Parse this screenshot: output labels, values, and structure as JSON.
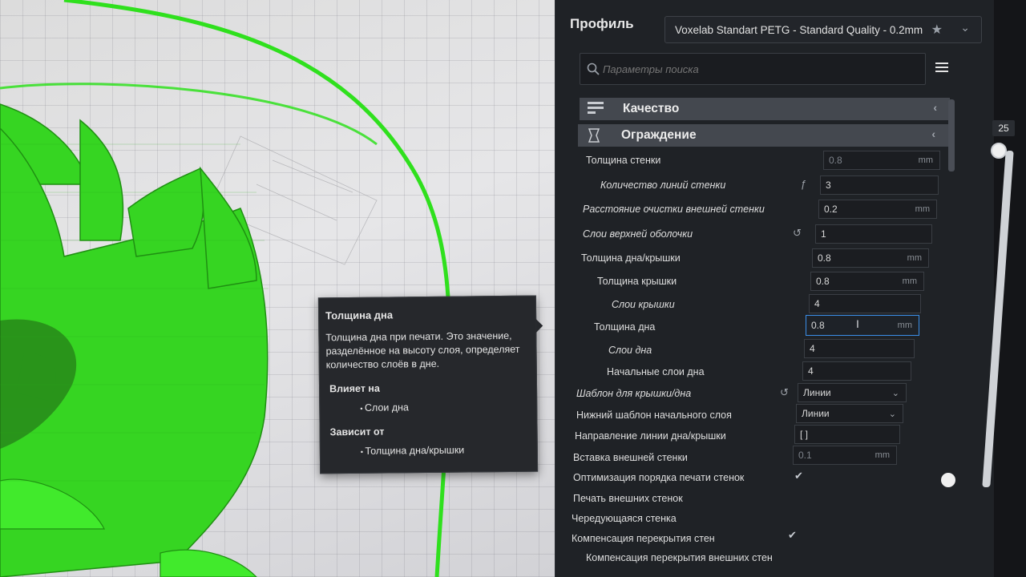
{
  "header": {
    "profile_label": "Профиль",
    "profile_value": "Voxelab Standart PETG - Standard Quality - 0.2mm"
  },
  "search": {
    "placeholder": "Параметры поиска"
  },
  "categories": [
    {
      "label": "Качество",
      "icon": "quality-icon"
    },
    {
      "label": "Ограждение",
      "icon": "shell-icon"
    }
  ],
  "settings": [
    {
      "label": "Толщина стенки",
      "value": "0.8",
      "unit": "mm"
    },
    {
      "label": "Количество линий стенки",
      "value": "3"
    },
    {
      "label": "Расстояние очистки внешней стенки",
      "value": "0.2",
      "unit": "mm"
    },
    {
      "label": "Слои верхней оболочки",
      "value": "1"
    },
    {
      "label": "Толщина дна/крышки",
      "value": "0.8",
      "unit": "mm"
    },
    {
      "label": "Толщина крышки",
      "value": "0.8",
      "unit": "mm"
    },
    {
      "label": "Слои крышки",
      "value": "4"
    },
    {
      "label": "Толщина дна",
      "value": "0.8",
      "unit": "mm"
    },
    {
      "label": "Слои дна",
      "value": "4"
    },
    {
      "label": "Начальные слои дна",
      "value": "4"
    },
    {
      "label": "Шаблон для крышки/дна",
      "value": "Линии"
    },
    {
      "label": "Нижний шаблон начального слоя",
      "value": "Линии"
    },
    {
      "label": "Направление линии дна/крышки",
      "value": "[ ]"
    },
    {
      "label": "Вставка внешней стенки",
      "value": "0.1",
      "unit": "mm"
    },
    {
      "label": "Оптимизация порядка печати стенок",
      "value": ""
    },
    {
      "label": "Печать внешних стенок",
      "value": ""
    },
    {
      "label": "Чередующаяся стенка",
      "value": ""
    },
    {
      "label": "Компенсация перекрытия стен",
      "value": ""
    },
    {
      "label": "Компенсация перекрытия внешних стен",
      "value": ""
    }
  ],
  "tooltip": {
    "title": "Толщина дна",
    "description": "Толщина дна при печати. Это значение, разделённое на высоту слоя, определяет количество слоёв в дне.",
    "affects_label": "Влияет на",
    "affects_item": "Слои дна",
    "depends_label": "Зависит от",
    "depends_item": "Толщина дна/крышки"
  },
  "layer_slider": {
    "value": "25"
  },
  "colors": {
    "model_green": "#3ee02a",
    "panel_bg": "#1f2226",
    "focus_blue": "#3b8ee8"
  }
}
